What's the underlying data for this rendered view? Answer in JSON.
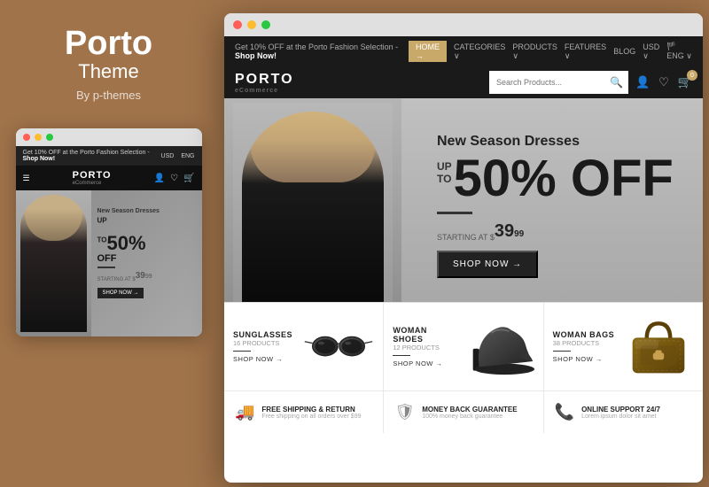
{
  "left": {
    "title": "Porto",
    "subtitle": "Theme",
    "by": "By p-themes"
  },
  "mini": {
    "topbar": {
      "promo": "Get 10% OFF at the Porto Fashion Selection - ",
      "shop_now": "Shop Now!",
      "currency": "USD",
      "lang": "ENG"
    },
    "logo": "PORTO",
    "logo_sub": "eCommerce",
    "hero": {
      "label": "New Season Dresses",
      "upto": "UP TO",
      "percent": "50%",
      "off": "OFF",
      "starting": "STARTING AT $",
      "price": "39",
      "cents": "99",
      "shop_btn": "SHOP NOW →"
    }
  },
  "main": {
    "topbar": {
      "promo": "Get 10% OFF at the Porto Fashion Selection - ",
      "shop_now": "Shop Now!",
      "menu_items": [
        "HOME →",
        "CATEGORIES ∨",
        "PRODUCTS ∨",
        "FEATURES ∨",
        "BLOG",
        "USD ∨",
        "ENG ∨"
      ]
    },
    "logo": "PORTO",
    "logo_sub": "eCommerce",
    "search_placeholder": "Search Products...",
    "nav_icons": {
      "user": "👤",
      "wish": "♡",
      "cart": "🛒",
      "cart_count": "0"
    },
    "hero": {
      "season": "New Season Dresses",
      "upto": "UPTO",
      "percent": "50% OFF",
      "starting_label": "STARTING AT $",
      "price": "39",
      "cents": "99",
      "shop_btn": "SHOP NOW →"
    },
    "categories": [
      {
        "title": "SUNGLASSES",
        "products": "16 PRODUCTS",
        "shop": "SHOP NOW →",
        "type": "glasses"
      },
      {
        "title": "WOMAN SHOES",
        "products": "12 PRODUCTS",
        "shop": "SHOP NOW →",
        "type": "shoes"
      },
      {
        "title": "WOMAN BAGS",
        "products": "38 PRODUCTS",
        "shop": "SHOP NOW →",
        "type": "bag"
      }
    ],
    "footer": [
      {
        "icon": "🚚",
        "title": "FREE SHIPPING & RETURN",
        "subtitle": "Free shipping on all orders over $99"
      },
      {
        "icon": "🛡",
        "title": "MONEY BACK GUARANTEE",
        "subtitle": "100% money back guarantee"
      },
      {
        "icon": "📞",
        "title": "ONLINE SUPPORT 24/7",
        "subtitle": "Lorem ipsum dolor sit amet"
      }
    ]
  },
  "colors": {
    "bg": "#a0734a",
    "dark": "#1a1a1a",
    "accent": "#c8a96a"
  }
}
